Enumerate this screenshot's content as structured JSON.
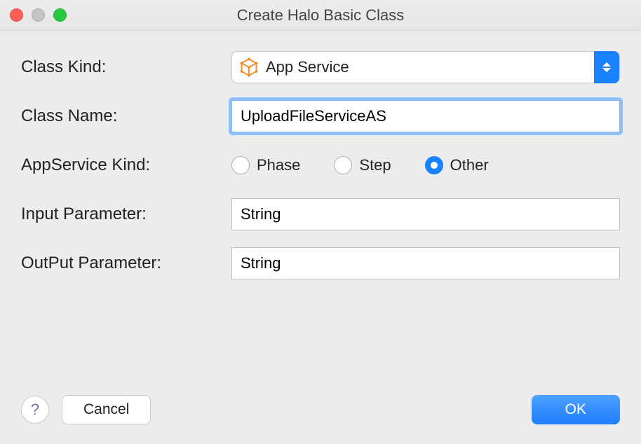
{
  "window": {
    "title": "Create Halo Basic Class"
  },
  "form": {
    "classKind": {
      "label": "Class Kind:",
      "value": "App Service",
      "icon": "cube-icon"
    },
    "className": {
      "label": "Class  Name:",
      "value": "UploadFileServiceAS"
    },
    "appServiceKind": {
      "label": "AppService Kind:",
      "options": [
        {
          "label": "Phase",
          "selected": false
        },
        {
          "label": "Step",
          "selected": false
        },
        {
          "label": "Other",
          "selected": true
        }
      ]
    },
    "inputParam": {
      "label": "Input Parameter:",
      "value": "String"
    },
    "outputParam": {
      "label": "OutPut Parameter:",
      "value": "String"
    }
  },
  "footer": {
    "help": "?",
    "cancel": "Cancel",
    "ok": "OK"
  }
}
